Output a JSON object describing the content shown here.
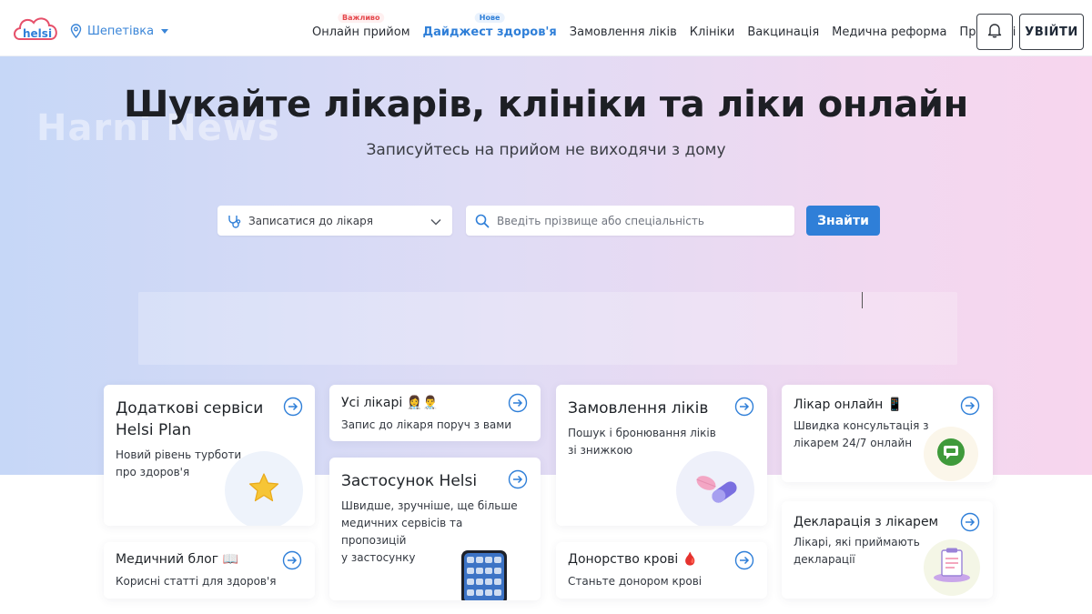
{
  "header": {
    "logo_text": "helsi",
    "city": "Шепетівка",
    "nav": [
      {
        "label": "Онлайн прийом",
        "badge": "Важливо",
        "badge_color": "red"
      },
      {
        "label": "Дайджест здоров'я",
        "badge": "Нове",
        "badge_color": "blue",
        "active": true
      },
      {
        "label": "Замовлення ліків"
      },
      {
        "label": "Клініки"
      },
      {
        "label": "Вакцинація"
      },
      {
        "label": "Медична реформа"
      },
      {
        "label": "Про Helsi"
      }
    ],
    "login_label": "УВІЙТИ"
  },
  "hero": {
    "watermark": "Harni News",
    "title": "Шукайте лікарів, клініки та ліки онлайн",
    "subtitle": "Записуйтесь на прийом не виходячи з дому",
    "select_label": "Записатися до лікаря",
    "search_placeholder": "Введіть прізвище або спеціальність",
    "find_label": "Знайти"
  },
  "cards": {
    "services": {
      "title_line1": "Додаткові сервіси",
      "title_line2": "Helsi Plan",
      "desc_line1": "Новий рівень турботи",
      "desc_line2": "про здоров'я"
    },
    "doctors": {
      "title": "Усі лікарі 👩‍⚕️👨‍⚕️",
      "desc": "Запис до лікаря поруч з вами"
    },
    "app": {
      "title": "Застосунок Helsi",
      "desc_line1": "Швидше, зручніше, ще більше",
      "desc_line2": "медичних сервісів та",
      "desc_line3": "пропозицій",
      "desc_line4": "у застосунку"
    },
    "medicine": {
      "title": "Замовлення ліків",
      "desc_line1": "Пошук і бронювання ліків",
      "desc_line2": "зі знижкою"
    },
    "online": {
      "title": "Лікар онлайн 📱",
      "desc_line1": "Швидка консультація з",
      "desc_line2": "лікарем 24/7 онлайн"
    },
    "declaration": {
      "title": "Декларація з лікарем",
      "desc_line1": "Лікарі, які приймають",
      "desc_line2": "декларації"
    },
    "blog": {
      "title": "Медичний блог 📖",
      "desc": "Корисні статті для здоров'я"
    },
    "blood": {
      "title": "Донорство крові 🩸",
      "desc": "Станьте донором крові"
    }
  },
  "colors": {
    "accent": "#2f7fd8",
    "important_badge": "#e5484d",
    "hero_gradient_start": "#c6d7f7",
    "hero_gradient_end": "#f7d6ee"
  },
  "icons": [
    "location-pin-icon",
    "bell-icon",
    "stethoscope-icon",
    "chevron-down-icon",
    "search-icon",
    "arrow-right-circle-icon",
    "star-icon",
    "pills-icon",
    "chat-icon",
    "clipboard-icon",
    "phone-icon"
  ]
}
